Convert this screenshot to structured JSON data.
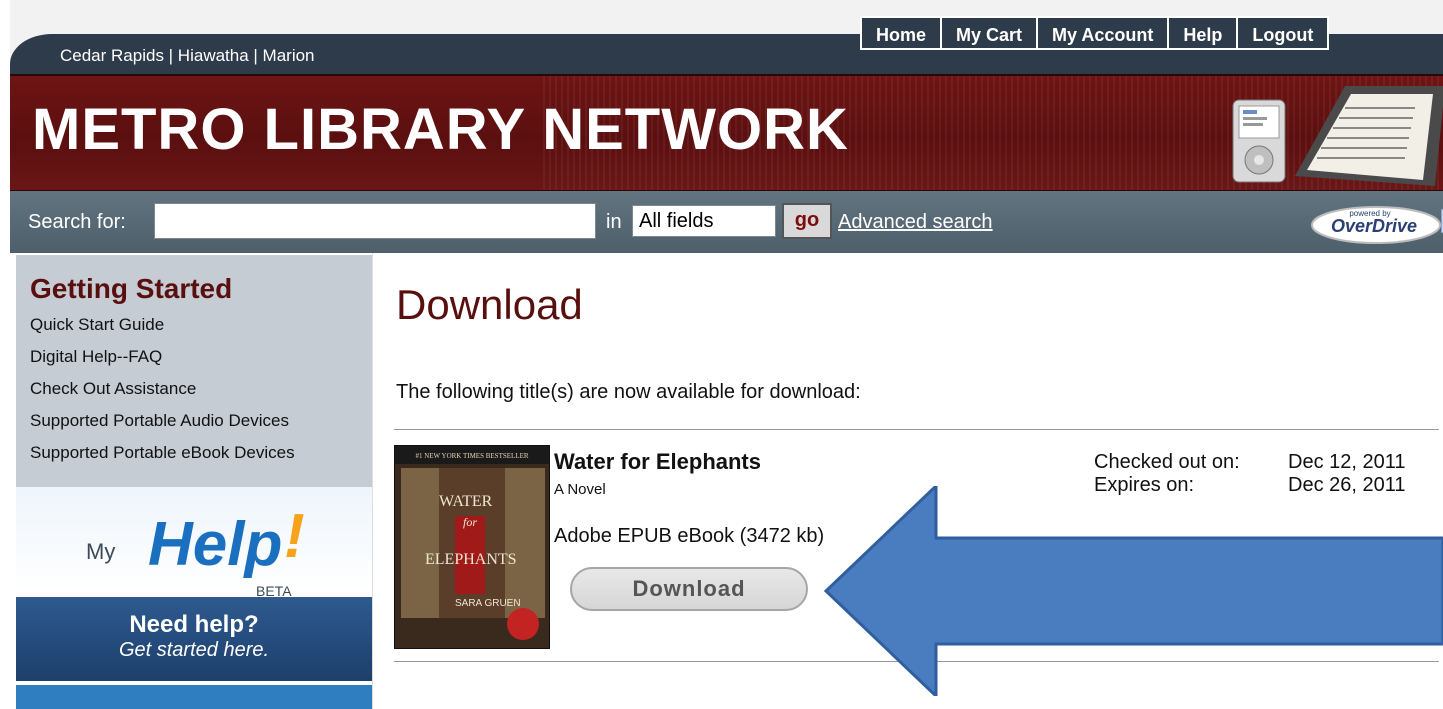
{
  "header": {
    "locations": "Cedar Rapids | Hiawatha | Marion",
    "nav": [
      "Home",
      "My Cart",
      "My Account",
      "Help",
      "Logout"
    ],
    "site_title": "METRO LIBRARY NETWORK"
  },
  "search": {
    "label": "Search for:",
    "input_value": "",
    "in_label": "in",
    "field_selected": "All fields",
    "go_label": "go",
    "advanced_label": "Advanced search",
    "overdrive_powered": "powered by",
    "overdrive_brand": "OverDrive"
  },
  "sidebar": {
    "title": "Getting Started",
    "links": [
      "Quick Start Guide",
      "Digital Help--FAQ",
      "Check Out Assistance",
      "Supported Portable Audio Devices",
      "Supported Portable eBook Devices"
    ],
    "myhelp": {
      "my": "My",
      "help": "Help",
      "bang": "!",
      "beta": "BETA"
    },
    "needhelp": {
      "line1": "Need help?",
      "line2": "Get started here."
    }
  },
  "main": {
    "title": "Download",
    "intro": "The following title(s) are now available for download:",
    "book": {
      "title": "Water for Elephants",
      "subtitle": "A Novel",
      "format": "Adobe EPUB eBook (3472 kb)",
      "download_label": "Download",
      "checked_out_label": "Checked out on:",
      "checked_out_value": "Dec 12, 2011",
      "expires_label": "Expires on:",
      "expires_value": "Dec 26, 2011",
      "cover_text": {
        "top": "#1 NEW YORK TIMES BESTSELLER",
        "w1": "WATER",
        "w2": "for",
        "w3": "ELEPHANTS",
        "author": "SARA GRUEN"
      }
    }
  },
  "colors": {
    "banner": "#6e1414",
    "nav_bg": "#2e3b4a",
    "searchbar": "#5a6b78",
    "accent_arrow": "#4a7cc0",
    "title_red": "#5a0f0f"
  }
}
